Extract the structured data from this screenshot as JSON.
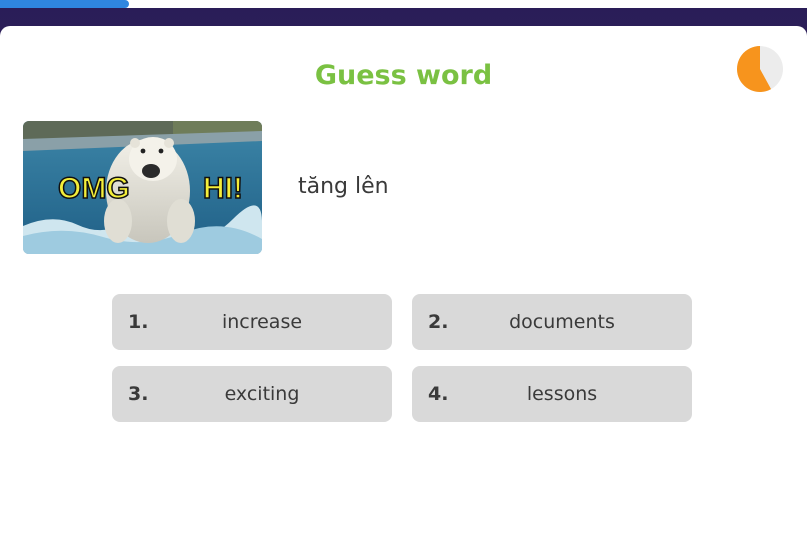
{
  "progress": {
    "fraction": 0.16,
    "color": "#2f86e0"
  },
  "title": "Guess word",
  "timer": {
    "remaining_fraction": 0.58,
    "fill_color": "#f7941d",
    "track_color": "#ececec"
  },
  "image": {
    "left_caption": "OMG",
    "right_caption": "HI!"
  },
  "word": "tăng lên",
  "options": [
    {
      "number": "1.",
      "text": "increase"
    },
    {
      "number": "2.",
      "text": "documents"
    },
    {
      "number": "3.",
      "text": "exciting"
    },
    {
      "number": "4.",
      "text": "lessons"
    }
  ],
  "colors": {
    "title": "#7ac142",
    "option_bg": "#d9d9d9",
    "background": "#2d1f5a"
  }
}
